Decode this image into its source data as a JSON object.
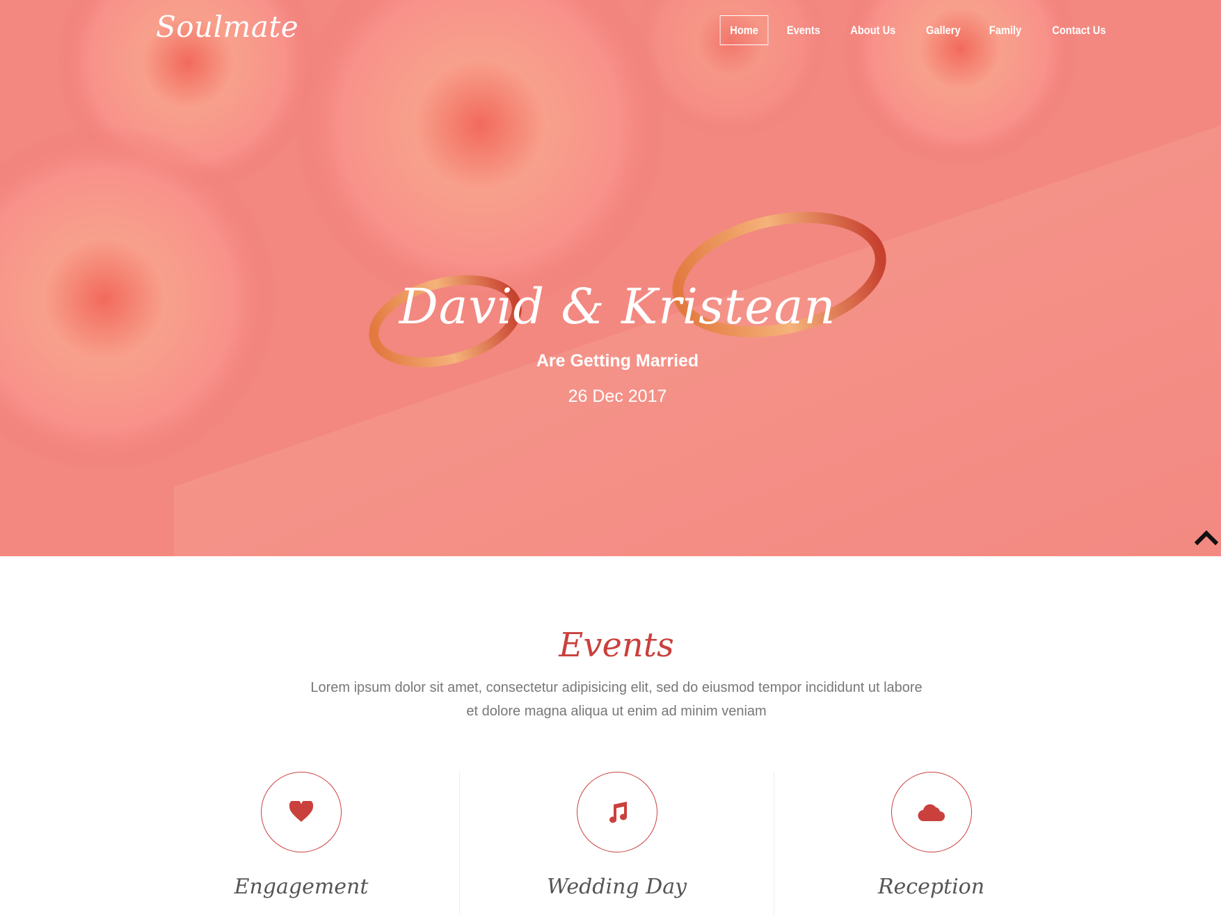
{
  "brand": {
    "logo_text": "Soulmate"
  },
  "nav": {
    "items": [
      {
        "label": "Home",
        "active": true
      },
      {
        "label": "Events",
        "active": false
      },
      {
        "label": "About Us",
        "active": false
      },
      {
        "label": "Gallery",
        "active": false
      },
      {
        "label": "Family",
        "active": false
      },
      {
        "label": "Contact Us",
        "active": false
      }
    ]
  },
  "hero": {
    "title": "David & Kristean",
    "subtitle": "Are Getting Married",
    "date": "26 Dec 2017",
    "overlay_color": "#f07a74"
  },
  "scroll_top": {
    "icon": "chevron-up-icon"
  },
  "events": {
    "title": "Events",
    "description": "Lorem ipsum dolor sit amet, consectetur adipisicing elit, sed do eiusmod tempor incididunt ut labore et dolore magna aliqua ut enim ad minim veniam",
    "accent_color": "#c9403c",
    "items": [
      {
        "label": "Engagement",
        "icon": "heart-icon"
      },
      {
        "label": "Wedding Day",
        "icon": "music-note-icon"
      },
      {
        "label": "Reception",
        "icon": "cloud-icon"
      }
    ]
  }
}
